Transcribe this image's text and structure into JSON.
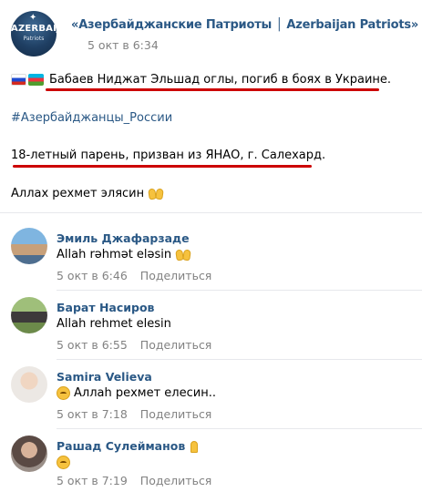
{
  "post": {
    "group_name": "«Азербайджанские Патриоты │ Azerbaijan Patriots»",
    "date": "5 окт в 6:34",
    "avatar_logo_line1": "AZERBAIJAN",
    "avatar_logo_line2": "Patriots",
    "line1_text": "Бабаев Ниджат Эльшад оглы, погиб в боях в Украине.",
    "line2_hashtag": "#Азербайджанцы_России",
    "line3_text": "18-летный парень, призван из ЯНАО, г. Салехард.",
    "line4_text": "Аллах рехмет элясин",
    "flags": [
      "flag-russia-icon",
      "flag-azerbaijan-icon"
    ]
  },
  "comments": [
    {
      "author": "Эмиль Джафарзаде",
      "text": "Allah rəhmət eləsin",
      "date": "5 окт в 6:46",
      "share": "Поделиться"
    },
    {
      "author": "Барат Насиров",
      "text": "Allah rehmet elesin",
      "date": "5 окт в 6:55",
      "share": "Поделиться"
    },
    {
      "author": "Samira Velieva",
      "text": "Аллаh рехмет елесин..",
      "date": "5 окт в 7:18",
      "share": "Поделиться"
    },
    {
      "author": "Рашад Сулейманов",
      "text": "",
      "date": "5 окт в 7:19",
      "share": "Поделиться"
    }
  ],
  "colors": {
    "link": "#2a5885",
    "meta": "#828282",
    "underline": "#cc0000",
    "divider": "#e7e8ec"
  }
}
